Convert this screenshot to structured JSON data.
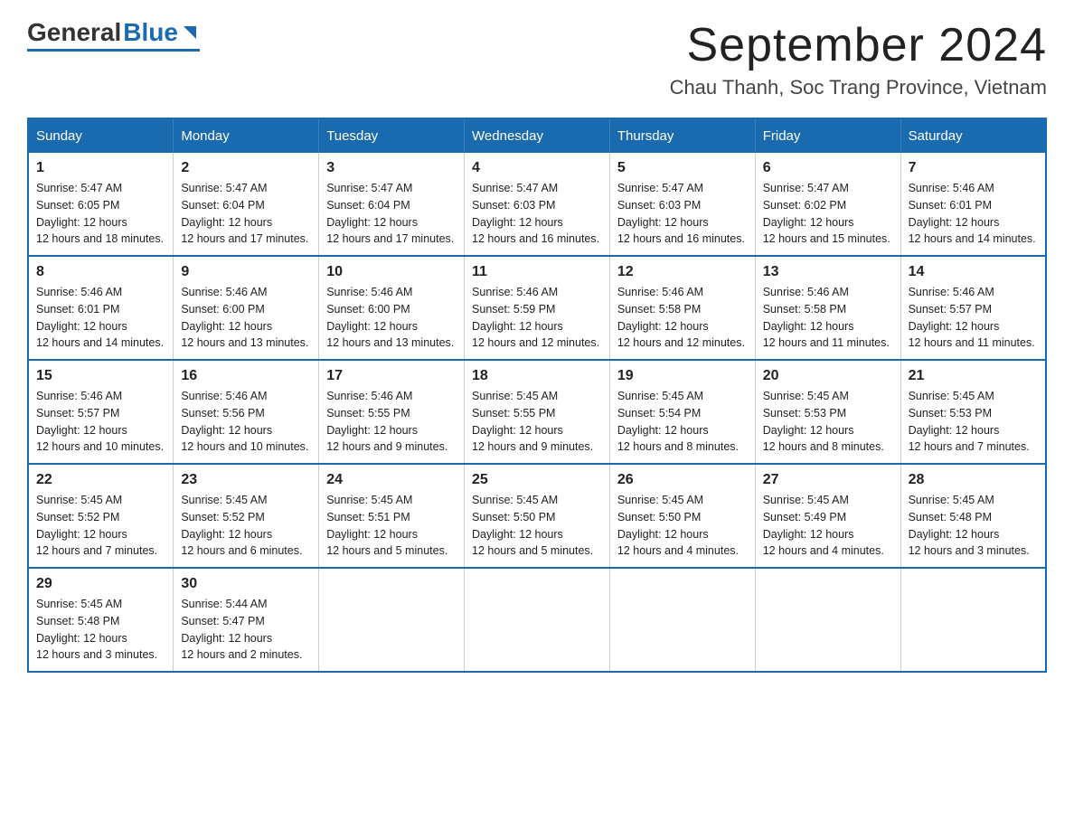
{
  "logo": {
    "general": "General",
    "blue": "Blue"
  },
  "title": "September 2024",
  "subtitle": "Chau Thanh, Soc Trang Province, Vietnam",
  "days_of_week": [
    "Sunday",
    "Monday",
    "Tuesday",
    "Wednesday",
    "Thursday",
    "Friday",
    "Saturday"
  ],
  "weeks": [
    [
      {
        "day": "1",
        "sunrise": "5:47 AM",
        "sunset": "6:05 PM",
        "daylight": "12 hours and 18 minutes."
      },
      {
        "day": "2",
        "sunrise": "5:47 AM",
        "sunset": "6:04 PM",
        "daylight": "12 hours and 17 minutes."
      },
      {
        "day": "3",
        "sunrise": "5:47 AM",
        "sunset": "6:04 PM",
        "daylight": "12 hours and 17 minutes."
      },
      {
        "day": "4",
        "sunrise": "5:47 AM",
        "sunset": "6:03 PM",
        "daylight": "12 hours and 16 minutes."
      },
      {
        "day": "5",
        "sunrise": "5:47 AM",
        "sunset": "6:03 PM",
        "daylight": "12 hours and 16 minutes."
      },
      {
        "day": "6",
        "sunrise": "5:47 AM",
        "sunset": "6:02 PM",
        "daylight": "12 hours and 15 minutes."
      },
      {
        "day": "7",
        "sunrise": "5:46 AM",
        "sunset": "6:01 PM",
        "daylight": "12 hours and 14 minutes."
      }
    ],
    [
      {
        "day": "8",
        "sunrise": "5:46 AM",
        "sunset": "6:01 PM",
        "daylight": "12 hours and 14 minutes."
      },
      {
        "day": "9",
        "sunrise": "5:46 AM",
        "sunset": "6:00 PM",
        "daylight": "12 hours and 13 minutes."
      },
      {
        "day": "10",
        "sunrise": "5:46 AM",
        "sunset": "6:00 PM",
        "daylight": "12 hours and 13 minutes."
      },
      {
        "day": "11",
        "sunrise": "5:46 AM",
        "sunset": "5:59 PM",
        "daylight": "12 hours and 12 minutes."
      },
      {
        "day": "12",
        "sunrise": "5:46 AM",
        "sunset": "5:58 PM",
        "daylight": "12 hours and 12 minutes."
      },
      {
        "day": "13",
        "sunrise": "5:46 AM",
        "sunset": "5:58 PM",
        "daylight": "12 hours and 11 minutes."
      },
      {
        "day": "14",
        "sunrise": "5:46 AM",
        "sunset": "5:57 PM",
        "daylight": "12 hours and 11 minutes."
      }
    ],
    [
      {
        "day": "15",
        "sunrise": "5:46 AM",
        "sunset": "5:57 PM",
        "daylight": "12 hours and 10 minutes."
      },
      {
        "day": "16",
        "sunrise": "5:46 AM",
        "sunset": "5:56 PM",
        "daylight": "12 hours and 10 minutes."
      },
      {
        "day": "17",
        "sunrise": "5:46 AM",
        "sunset": "5:55 PM",
        "daylight": "12 hours and 9 minutes."
      },
      {
        "day": "18",
        "sunrise": "5:45 AM",
        "sunset": "5:55 PM",
        "daylight": "12 hours and 9 minutes."
      },
      {
        "day": "19",
        "sunrise": "5:45 AM",
        "sunset": "5:54 PM",
        "daylight": "12 hours and 8 minutes."
      },
      {
        "day": "20",
        "sunrise": "5:45 AM",
        "sunset": "5:53 PM",
        "daylight": "12 hours and 8 minutes."
      },
      {
        "day": "21",
        "sunrise": "5:45 AM",
        "sunset": "5:53 PM",
        "daylight": "12 hours and 7 minutes."
      }
    ],
    [
      {
        "day": "22",
        "sunrise": "5:45 AM",
        "sunset": "5:52 PM",
        "daylight": "12 hours and 7 minutes."
      },
      {
        "day": "23",
        "sunrise": "5:45 AM",
        "sunset": "5:52 PM",
        "daylight": "12 hours and 6 minutes."
      },
      {
        "day": "24",
        "sunrise": "5:45 AM",
        "sunset": "5:51 PM",
        "daylight": "12 hours and 5 minutes."
      },
      {
        "day": "25",
        "sunrise": "5:45 AM",
        "sunset": "5:50 PM",
        "daylight": "12 hours and 5 minutes."
      },
      {
        "day": "26",
        "sunrise": "5:45 AM",
        "sunset": "5:50 PM",
        "daylight": "12 hours and 4 minutes."
      },
      {
        "day": "27",
        "sunrise": "5:45 AM",
        "sunset": "5:49 PM",
        "daylight": "12 hours and 4 minutes."
      },
      {
        "day": "28",
        "sunrise": "5:45 AM",
        "sunset": "5:48 PM",
        "daylight": "12 hours and 3 minutes."
      }
    ],
    [
      {
        "day": "29",
        "sunrise": "5:45 AM",
        "sunset": "5:48 PM",
        "daylight": "12 hours and 3 minutes."
      },
      {
        "day": "30",
        "sunrise": "5:44 AM",
        "sunset": "5:47 PM",
        "daylight": "12 hours and 2 minutes."
      },
      null,
      null,
      null,
      null,
      null
    ]
  ]
}
